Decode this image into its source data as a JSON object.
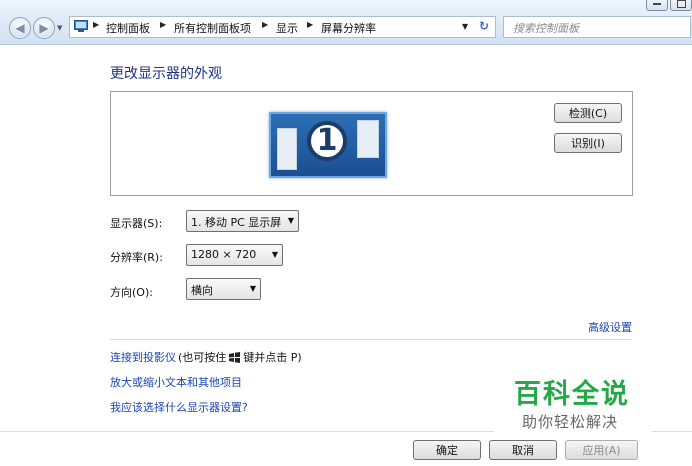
{
  "address_bar": {
    "breadcrumbs": [
      "控制面板",
      "所有控制面板项",
      "显示",
      "屏幕分辨率"
    ],
    "search_placeholder": "搜索控制面板"
  },
  "page": {
    "title": "更改显示器的外观",
    "monitor_number": "1",
    "detect_button": "检测(C)",
    "identify_button": "识别(I)",
    "display_label": "显示器(S):",
    "display_value": "1. 移动 PC 显示屏",
    "resolution_label": "分辨率(R):",
    "resolution_value": "1280 × 720",
    "orientation_label": "方向(O):",
    "orientation_value": "横向",
    "advanced_link": "高级设置",
    "projector_link": "连接到投影仪",
    "projector_hint_prefix": "(也可按住",
    "projector_hint_suffix": "键并点击 P)",
    "text_size_link": "放大或缩小文本和其他项目",
    "help_link": "我应该选择什么显示器设置?"
  },
  "footer": {
    "ok_button": "确定",
    "cancel_button": "取消",
    "apply_button": "应用(A)"
  },
  "watermark": {
    "title": "百科全说",
    "subtitle": "助你轻松解决"
  },
  "colors": {
    "title_blue": "#1e3287",
    "link_blue": "#1a46b5",
    "watermark_green": "#26a84a"
  }
}
